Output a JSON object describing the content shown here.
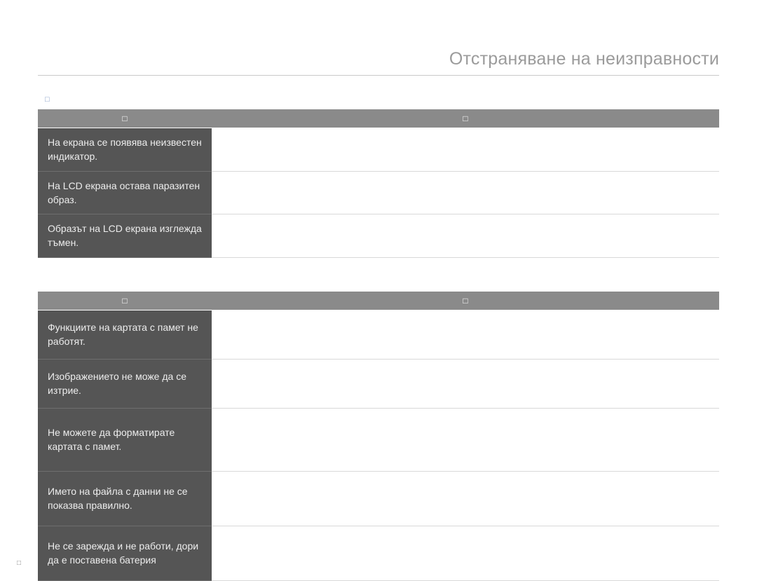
{
  "header": {
    "title": "Отстраняване на неизправности"
  },
  "sections": [
    {
      "label": "□",
      "head": {
        "symptom": "□",
        "remedy": "□"
      },
      "rows": [
        {
          "symptom": "На екрана се появява неизвестен индикатор.",
          "remedy": ""
        },
        {
          "symptom": "На LCD екрана остава паразитен образ.",
          "remedy": ""
        },
        {
          "symptom": "Образът на LCD екрана изглежда тъмен.",
          "remedy": ""
        }
      ]
    },
    {
      "label": "",
      "head": {
        "symptom": "□",
        "remedy": "□"
      },
      "rows": [
        {
          "symptom": "Функциите на картата с памет не работят.",
          "remedy": ""
        },
        {
          "symptom": "Изображението не може да се изтрие.",
          "remedy": ""
        },
        {
          "symptom": "Не можете да форматирате картата с памет.",
          "remedy": ""
        },
        {
          "symptom": "Името на файла с данни не се показва правилно.",
          "remedy": ""
        },
        {
          "symptom": "Не се зарежда и не работи, дори да е поставена батерия",
          "remedy": ""
        }
      ]
    }
  ],
  "footer": {
    "page": "□"
  }
}
